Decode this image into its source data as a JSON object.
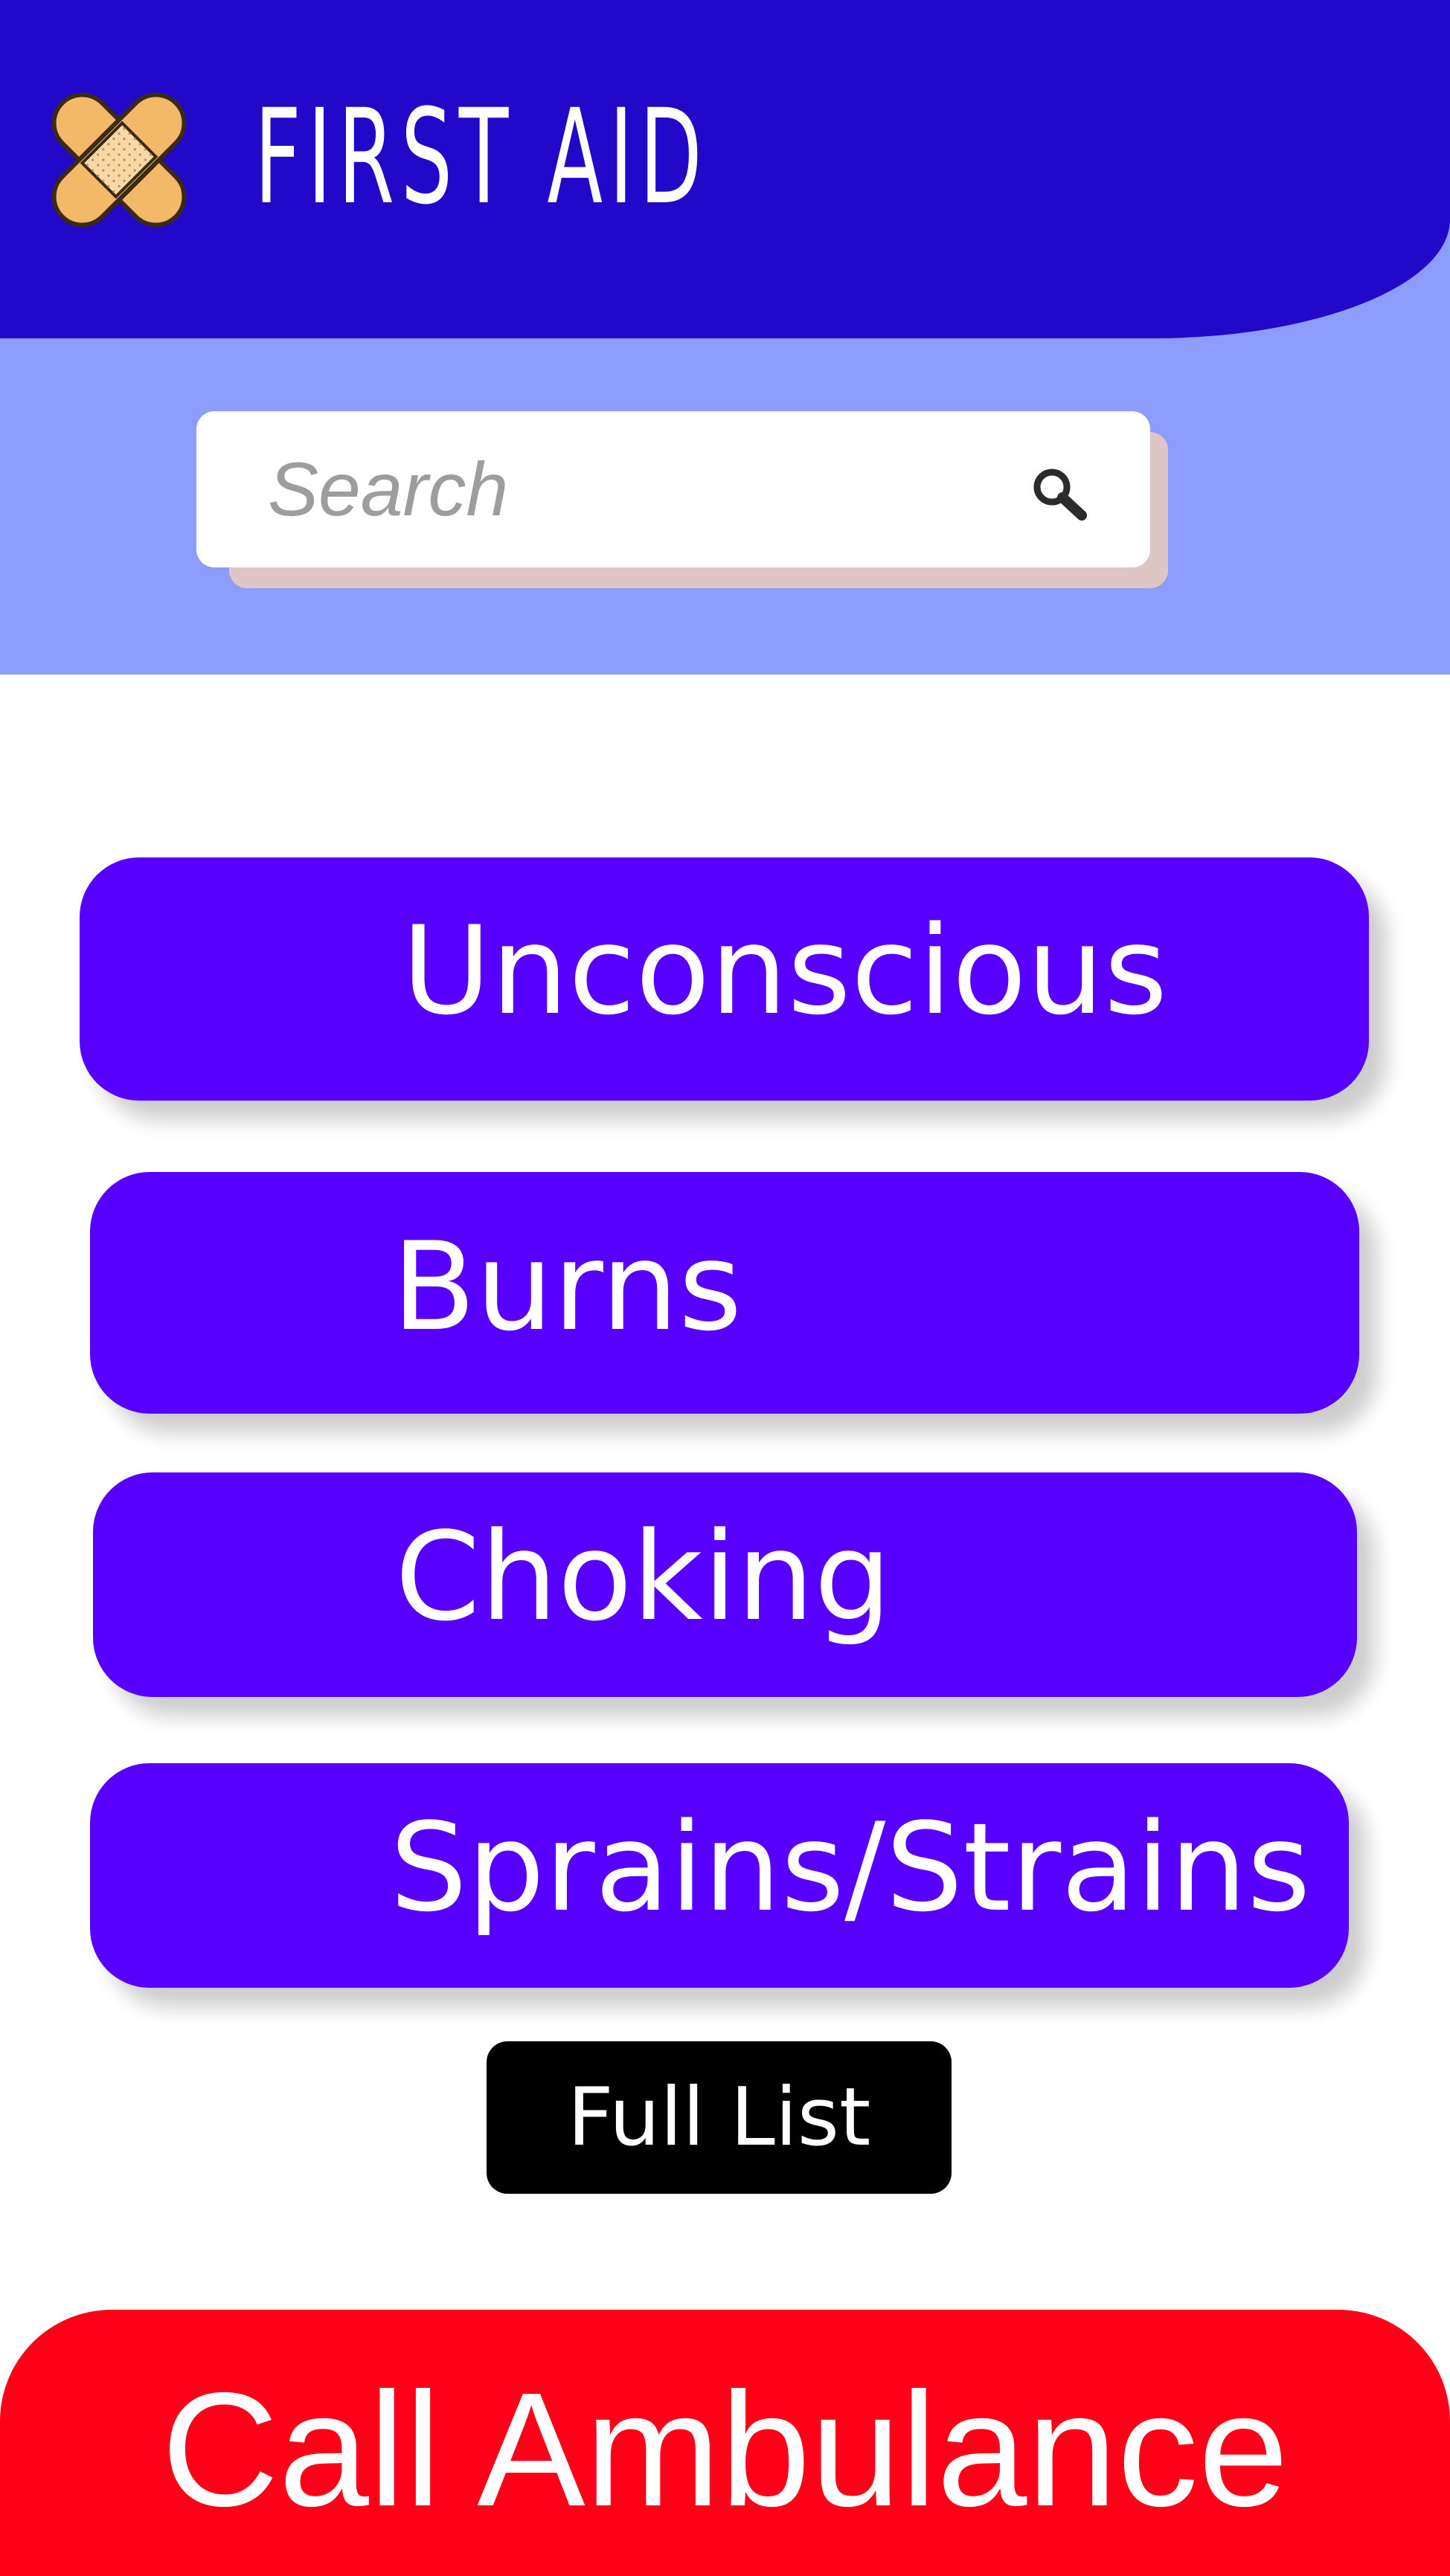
{
  "app": {
    "title": "FIRST AID",
    "logo_icon": "crossed-bandages-logo"
  },
  "search": {
    "placeholder": "Search",
    "value": "",
    "icon": "search-icon"
  },
  "topics": [
    {
      "label": "Unconscious"
    },
    {
      "label": "Burns"
    },
    {
      "label": "Choking"
    },
    {
      "label": "Sprains/Strains"
    }
  ],
  "full_list": {
    "label": "Full List"
  },
  "ambulance": {
    "label": "Call Ambulance"
  },
  "colors": {
    "header": "#2208c9",
    "search_band": "#8c9dfd",
    "topic_button": "#5700ff",
    "full_list_button": "#000000",
    "ambulance_button": "#ff0019",
    "text": "#ffffff"
  }
}
